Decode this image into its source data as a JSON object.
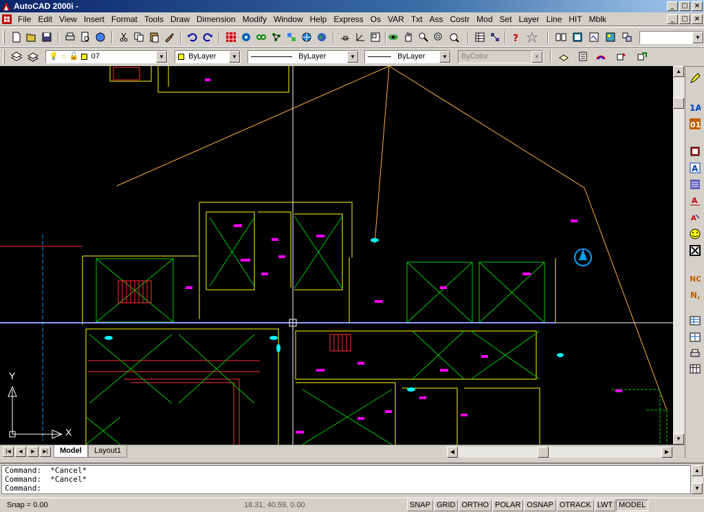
{
  "window": {
    "title": "AutoCAD 2000i -",
    "min": "_",
    "max": "□",
    "close": "×"
  },
  "menu": [
    "File",
    "Edit",
    "View",
    "Insert",
    "Format",
    "Tools",
    "Draw",
    "Dimension",
    "Modify",
    "Window",
    "Help",
    "Express",
    "Os",
    "VAR",
    "Txt",
    "Ass",
    "Costr",
    "Mod",
    "Set",
    "Layer",
    "Line",
    "HIT",
    "Mblk"
  ],
  "properties": {
    "layer": "07",
    "color": "ByLayer",
    "linetype": "ByLayer",
    "lineweight": "ByLayer",
    "plotstyle": "ByColor"
  },
  "tabs": {
    "model": "Model",
    "layout1": "Layout1"
  },
  "ucs": {
    "x": "X",
    "y": "Y"
  },
  "command": {
    "lines": [
      "Command:  *Cancel*",
      "Command:  *Cancel*"
    ],
    "prompt": "Command:"
  },
  "status": {
    "snap": "Snap = 0.00",
    "coords": "18.31, 40.59, 0.00",
    "modes": [
      {
        "label": "SNAP",
        "on": false
      },
      {
        "label": "GRID",
        "on": false
      },
      {
        "label": "ORTHO",
        "on": false
      },
      {
        "label": "POLAR",
        "on": false
      },
      {
        "label": "OSNAP",
        "on": false
      },
      {
        "label": "OTRACK",
        "on": false
      },
      {
        "label": "LWT",
        "on": false
      },
      {
        "label": "MODEL",
        "on": true
      }
    ]
  },
  "colors": {
    "canvas": "#000000",
    "yellow": "#ffff00",
    "green": "#00cc00",
    "magenta": "#ff00ff",
    "red": "#ff3030",
    "cyan": "#00ffff",
    "orange": "#ffb040"
  }
}
